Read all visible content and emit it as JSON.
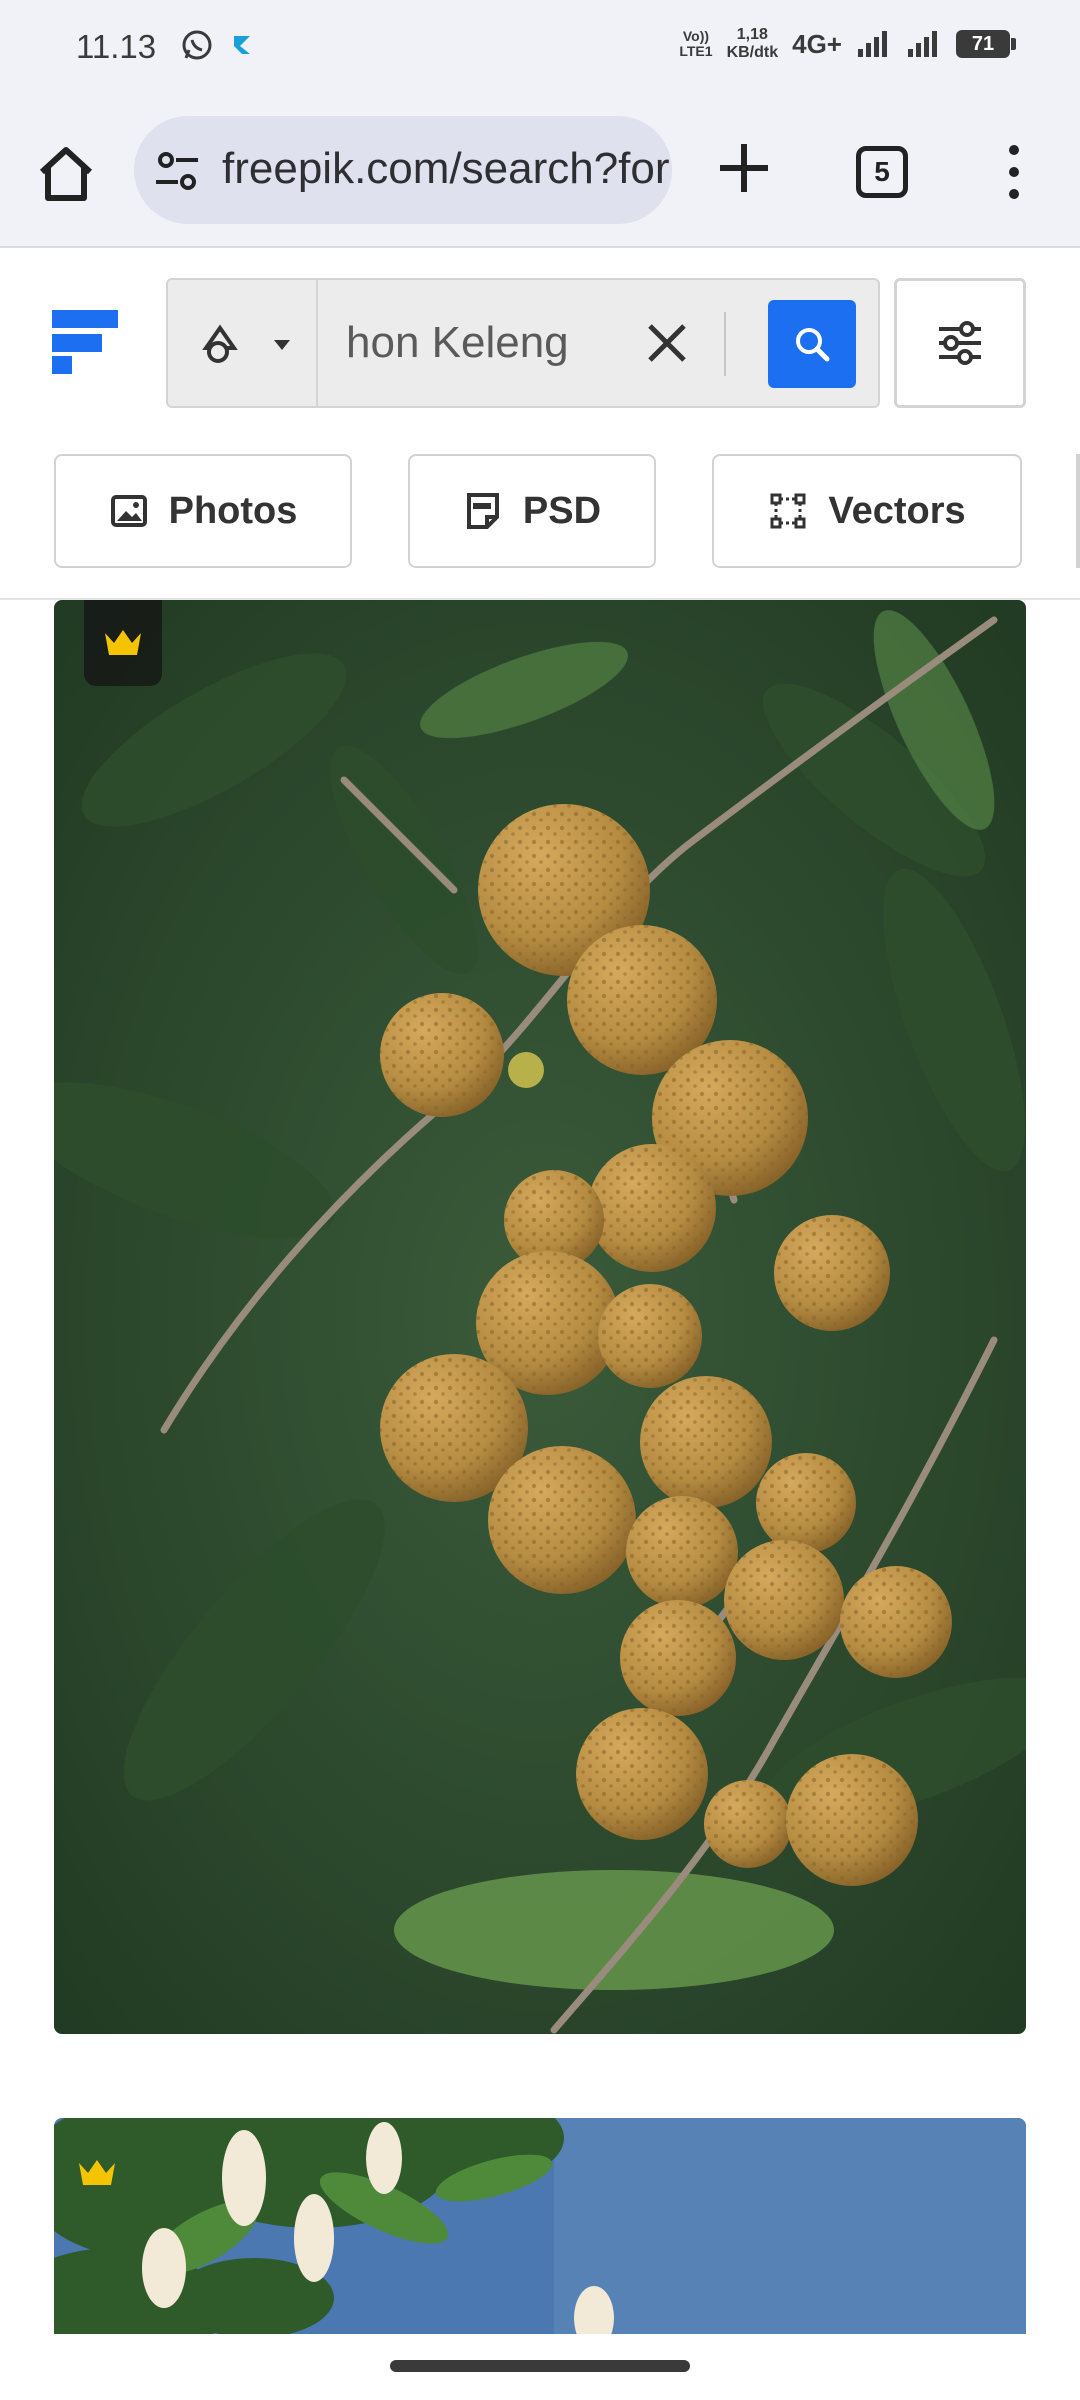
{
  "status_bar": {
    "time": "11.13",
    "volte_top": "Vo))",
    "volte_bottom": "LTE1",
    "speed_top": "1,18",
    "speed_bottom": "KB/dtk",
    "network": "4G+",
    "battery": "71"
  },
  "browser": {
    "url": "freepik.com/search?format=search&query=Pohon Kelengkeng",
    "tab_count": "5"
  },
  "search": {
    "query": "hon Keleng",
    "colors": {
      "accent": "#1d6ff2"
    }
  },
  "filters": [
    {
      "label": "Photos",
      "icon": "image-icon"
    },
    {
      "label": "PSD",
      "icon": "psd-icon"
    },
    {
      "label": "Vectors",
      "icon": "vector-icon"
    }
  ],
  "results": [
    {
      "type": "photo",
      "premium": true,
      "subject": "longan"
    },
    {
      "type": "photo",
      "premium": true,
      "subject": "flowering tree"
    }
  ]
}
